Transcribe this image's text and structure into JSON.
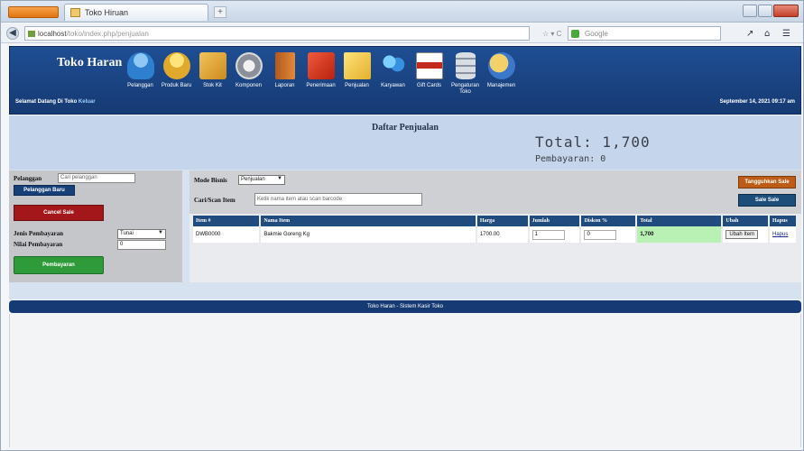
{
  "browser": {
    "tab_title": "Toko Hiruan",
    "url": "localhost",
    "url_tail": "/toko/index.php/penjualan",
    "search_placeholder": "Google"
  },
  "header": {
    "brand": "Toko Haran",
    "menu": [
      {
        "label": "Pelanggan",
        "icon": "user-icon"
      },
      {
        "label": "Produk Baru",
        "icon": "user-gold-icon"
      },
      {
        "label": "Stok Kit",
        "icon": "box-icon"
      },
      {
        "label": "Komponen",
        "icon": "gear-icon"
      },
      {
        "label": "Laporan",
        "icon": "door-icon"
      },
      {
        "label": "Penerimaan",
        "icon": "report-icon"
      },
      {
        "label": "Penjualan",
        "icon": "note-icon"
      },
      {
        "label": "Karyawan",
        "icon": "people-icon"
      },
      {
        "label": "Gift Cards",
        "icon": "card-icon"
      },
      {
        "label": "Pengaturan Toko",
        "icon": "database-icon"
      },
      {
        "label": "Manajemen",
        "icon": "manage-icon"
      }
    ],
    "welcome": "Selamat Datang Di Toko",
    "welcome_link": "Keluar",
    "datetime": "September 14, 2021 09:17 am"
  },
  "summary": {
    "title": "Daftar Penjualan",
    "total": "Total: 1,700",
    "payment": "Pembayaran: 0"
  },
  "left": {
    "customer_label": "Pelanggan",
    "customer_placeholder": "Cari pelanggan",
    "new_customer_btn": "Pelanggan Baru",
    "cancel_btn": "Cancel Sale",
    "payment_type_label": "Jenis Pembayaran",
    "payment_type_value": "Tunai",
    "payment_value_label": "Nilai Pembayaran",
    "payment_value": "0",
    "pay_btn": "Pembayaran"
  },
  "main": {
    "mode_label": "Mode Bisnis",
    "mode_value": "Penjualan",
    "search_label": "Cari/Scan Item",
    "search_placeholder": "Ketik nama item atau scan barcode",
    "suspend_btn": "Tangguhkan Sale",
    "suspended_btn": "Sale Sale",
    "columns": [
      "Item #",
      "Nama Item",
      "Harga",
      "Jumlah",
      "Diskon %",
      "Total",
      "Ubah",
      "Hapus"
    ],
    "rows": [
      {
        "item": "DWB0000",
        "name": "Bakmie Goreng Kg",
        "price": "1700.00",
        "qty": "1",
        "discount": "0",
        "total": "1,700",
        "edit": "Ubah Item",
        "delete": "Hapus"
      }
    ]
  },
  "footer": {
    "text": "Toko Haran - Sistem Kasir Toko"
  },
  "colors": {
    "header": "#1f4e93",
    "accent_orange": "#bd5c16",
    "total_green": "#b9f0b4"
  }
}
